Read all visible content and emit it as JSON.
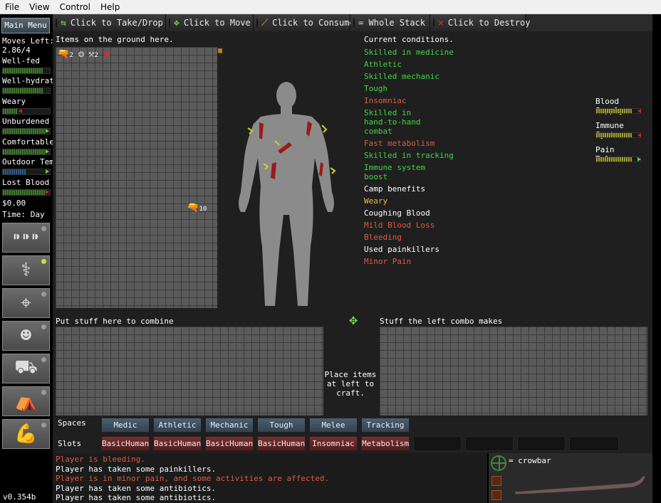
{
  "menu": [
    "File",
    "View",
    "Control",
    "Help"
  ],
  "sidebar": {
    "main_menu": "Main Menu",
    "moves_left_label": "Moves Left:",
    "moves_left_value": "2.86/4",
    "stats": [
      {
        "label": "Well-fed",
        "level": 0.85,
        "arrow": "none"
      },
      {
        "label": "Well-hydrate",
        "level": 0.85,
        "arrow": "none"
      },
      {
        "label": "Weary",
        "level": 0.3,
        "arrow": "red-left"
      },
      {
        "label": "Unburdened",
        "level": 0.9,
        "arrow": "green"
      },
      {
        "label": "Comfortable",
        "level": 0.9,
        "arrow": "green"
      },
      {
        "label": "Outdoor Tem",
        "level": 0.5,
        "arrow": "green"
      },
      {
        "label": "Lost Blood",
        "level": 0.9,
        "arrow": "red"
      }
    ],
    "money": "$0.00",
    "time": "Time: Day",
    "icons": [
      "bullets-icon",
      "caduceus-icon",
      "crosshair-icon",
      "survivor-icon",
      "truck-icon",
      "tent-icon",
      "muscle-icon"
    ],
    "version": "v0.354b"
  },
  "toolbar": [
    {
      "label": "Click to Take/Drop",
      "color": "#4caf2a",
      "icon": "arrows-icon"
    },
    {
      "label": "Click to Move",
      "color": "#4caf2a",
      "icon": "move-icon"
    },
    {
      "label": "Click to Consume",
      "color": "#6b8a2a",
      "icon": "syringe-icon"
    },
    {
      "label": "= Whole Stack",
      "color": "#d02020",
      "icon": "none"
    },
    {
      "label": "Click to Destroy",
      "color": "#8a1010",
      "icon": "x-icon"
    }
  ],
  "ground": {
    "label": "Items on the ground here.",
    "items": [
      {
        "icon": "gun-icon",
        "qty": "2"
      },
      {
        "icon": "bandage-icon",
        "qty": ""
      },
      {
        "icon": "crowbar-icon",
        "qty": "2"
      },
      {
        "icon": "medkit-icon",
        "qty": ""
      }
    ],
    "floor_item": {
      "icon": "gun-icon",
      "qty": "10"
    }
  },
  "conditions": {
    "title": "Current conditions.",
    "items": [
      {
        "text": "Skilled in medicine",
        "color": "#3fd63f"
      },
      {
        "text": "Athletic",
        "color": "#3fd63f"
      },
      {
        "text": "Skilled mechanic",
        "color": "#3fd63f"
      },
      {
        "text": "Tough",
        "color": "#3fd63f"
      },
      {
        "text": "Insomniac",
        "color": "#e05a3c"
      },
      {
        "text": "Skilled in hand-to-hand combat",
        "color": "#3fd63f"
      },
      {
        "text": "Fast metabolism",
        "color": "#e05a3c"
      },
      {
        "text": "Skilled in tracking",
        "color": "#3fd63f"
      },
      {
        "text": "Immune system boost",
        "color": "#3fd63f"
      },
      {
        "text": "Camp benefits",
        "color": "#ffffff"
      },
      {
        "text": "Weary",
        "color": "#e0c030"
      },
      {
        "text": "Coughing Blood",
        "color": "#ffffff"
      },
      {
        "text": "Mild Blood Loss",
        "color": "#e05a3c"
      },
      {
        "text": "Bleeding",
        "color": "#e05a3c"
      },
      {
        "text": "Used painkillers",
        "color": "#ffffff"
      },
      {
        "text": "Minor Pain",
        "color": "#e05a3c"
      }
    ]
  },
  "right_stats": [
    {
      "label": "Blood Supply:",
      "level": 0.8
    },
    {
      "label": "Immune System",
      "level": 0.8
    },
    {
      "label": "Pain Tolerance",
      "level": 0.8
    }
  ],
  "combine": {
    "left_label": "Put stuff here to combine",
    "right_label": "Stuff the left combo makes",
    "message": "Place items at left to craft."
  },
  "spaces": {
    "label": "Spaces",
    "items": [
      "Medic",
      "Athletic",
      "Mechanic",
      "Tough",
      "Melee",
      "Tracking"
    ]
  },
  "slots": {
    "label": "Slots",
    "items": [
      "BasicHuman",
      "BasicHuman",
      "BasicHuman",
      "BasicHuman",
      "Insomniac",
      "Metabolism"
    ]
  },
  "log": [
    {
      "text": "Player is bleeding.",
      "color": "red"
    },
    {
      "text": "Player has taken some painkillers.",
      "color": "white"
    },
    {
      "text": "Player is in minor pain, and some activities are affected.",
      "color": "red"
    },
    {
      "text": "Player has taken some antibiotics.",
      "color": "white"
    },
    {
      "text": "Player has taken some antibiotics.",
      "color": "white"
    }
  ],
  "equipped": {
    "label": "= crowbar"
  }
}
